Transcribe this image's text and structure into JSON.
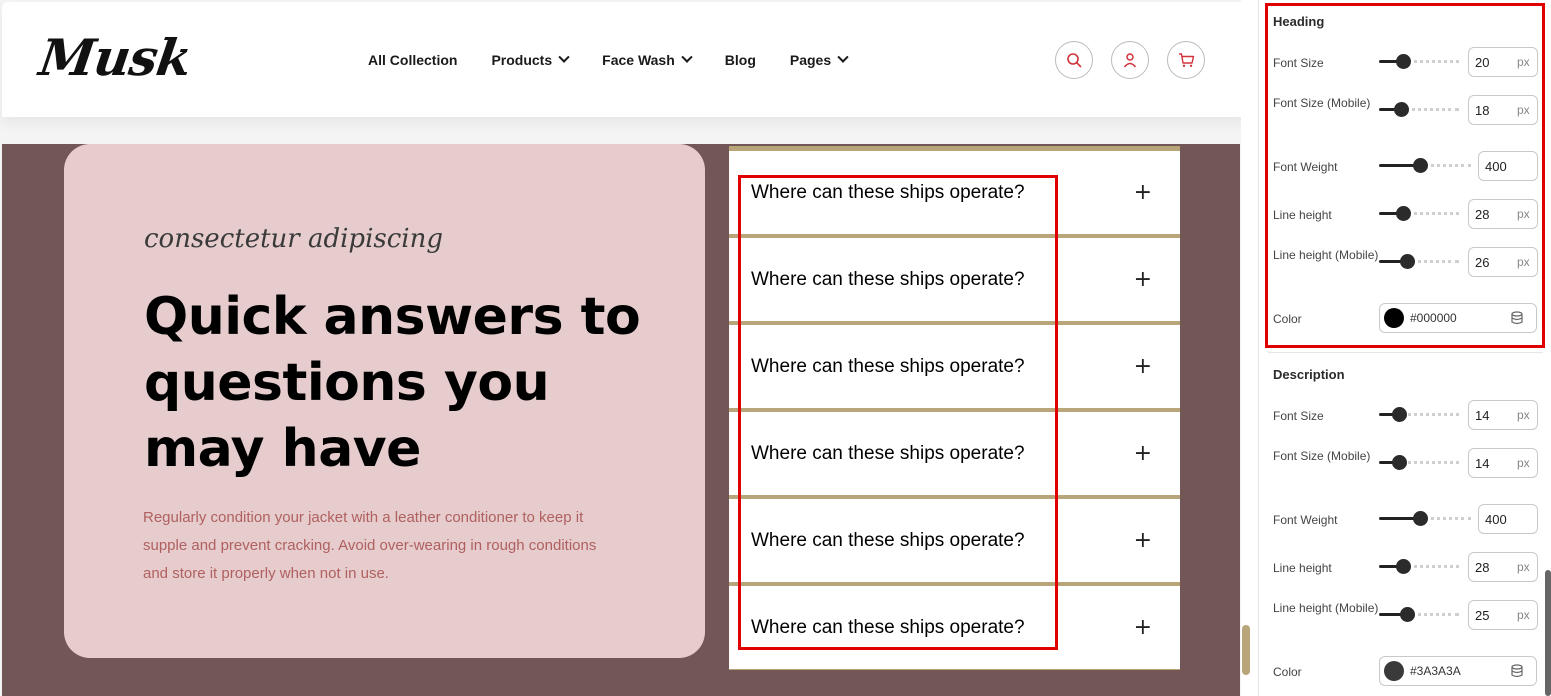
{
  "header": {
    "logo": "Musk",
    "nav": [
      {
        "label": "All Collection",
        "dropdown": false
      },
      {
        "label": "Products",
        "dropdown": true
      },
      {
        "label": "Face Wash",
        "dropdown": true
      },
      {
        "label": "Blog",
        "dropdown": false
      },
      {
        "label": "Pages",
        "dropdown": true
      }
    ],
    "icons": [
      "search-icon",
      "user-icon",
      "cart-icon"
    ],
    "icon_color": "#d0333a"
  },
  "hero": {
    "subtitle": "consectetur adipiscing",
    "title": "Quick answers to questions you may have",
    "description": "Regularly condition your jacket with a leather conditioner to keep it supple and prevent cracking. Avoid over-wearing in rough conditions and store it properly when not in use.",
    "section_bg": "#735656",
    "card_bg": "#e6cccc",
    "description_color": "#b06060"
  },
  "faq": {
    "items": [
      "Where can these ships operate?",
      "Where can these ships operate?",
      "Where can these ships operate?",
      "Where can these ships operate?",
      "Where can these ships operate?",
      "Where can these ships operate?"
    ],
    "toggle": "+",
    "divider_color": "#b8a57a"
  },
  "panel": {
    "heading": {
      "title": "Heading",
      "rows": [
        {
          "label": "Font Size",
          "value": "20",
          "unit": "px",
          "level": 0.25
        },
        {
          "label": "Font Size (Mobile)",
          "value": "18",
          "unit": "px",
          "level": 0.22
        },
        {
          "label": "Font Weight",
          "value": "400",
          "unit": "",
          "level": 0.4
        },
        {
          "label": "Line height",
          "value": "28",
          "unit": "px",
          "level": 0.25
        },
        {
          "label": "Line height (Mobile)",
          "value": "26",
          "unit": "px",
          "level": 0.3
        }
      ],
      "color_label": "Color",
      "color_value": "#000000",
      "color_swatch": "#000000"
    },
    "description": {
      "title": "Description",
      "rows": [
        {
          "label": "Font Size",
          "value": "14",
          "unit": "px",
          "level": 0.2
        },
        {
          "label": "Font Size (Mobile)",
          "value": "14",
          "unit": "px",
          "level": 0.2
        },
        {
          "label": "Font Weight",
          "value": "400",
          "unit": "",
          "level": 0.4
        },
        {
          "label": "Line height",
          "value": "28",
          "unit": "px",
          "level": 0.25
        },
        {
          "label": "Line height (Mobile)",
          "value": "25",
          "unit": "px",
          "level": 0.3
        }
      ],
      "color_label": "Color",
      "color_value": "#3A3A3A",
      "color_swatch": "#3a3a3a"
    }
  }
}
